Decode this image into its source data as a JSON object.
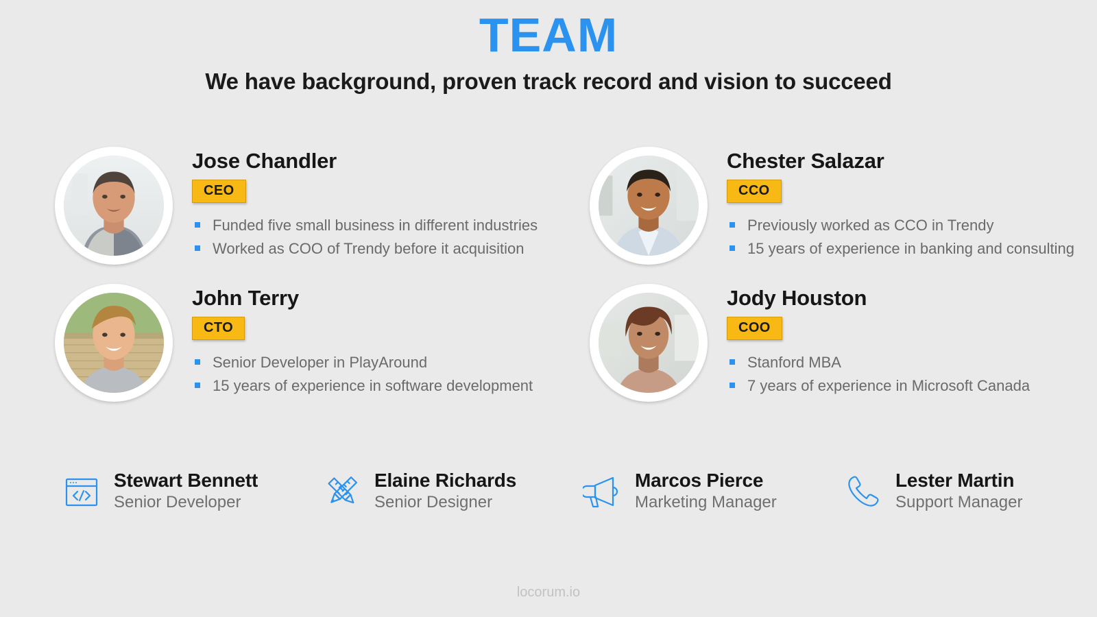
{
  "header": {
    "title": "TEAM",
    "subtitle": "We have background, proven track record and vision to succeed"
  },
  "colors": {
    "background": "#eaeaea",
    "accent_blue": "#2b93ef",
    "badge_amber": "#f9b915",
    "heading_dark": "#161616",
    "body_gray": "#6a6a6a",
    "footer_gray": "#c2c2c2"
  },
  "leaders": [
    {
      "name": "Jose Chandler",
      "badge": "CEO",
      "avatar": "photo-jose-chandler",
      "bullets": [
        "Funded five small business in different industries",
        "Worked as COO of Trendy before it acquisition"
      ]
    },
    {
      "name": "Chester Salazar",
      "badge": "CCO",
      "avatar": "photo-chester-salazar",
      "bullets": [
        "Previously worked as CCO in Trendy",
        "15 years of experience in banking and consulting"
      ]
    },
    {
      "name": "John Terry",
      "badge": "CTO",
      "avatar": "photo-john-terry",
      "bullets": [
        "Senior Developer in PlayAround",
        "15 years of experience in software development"
      ]
    },
    {
      "name": "Jody Houston",
      "badge": "COO",
      "avatar": "photo-jody-houston",
      "bullets": [
        "Stanford MBA",
        "7 years of experience in Microsoft Canada"
      ]
    }
  ],
  "staff": [
    {
      "name": "Stewart Bennett",
      "role": "Senior Developer",
      "icon": "code-window-icon"
    },
    {
      "name": "Elaine Richards",
      "role": "Senior Designer",
      "icon": "pencil-ruler-icon"
    },
    {
      "name": "Marcos Pierce",
      "role": "Marketing Manager",
      "icon": "megaphone-icon"
    },
    {
      "name": "Lester Martin",
      "role": "Support Manager",
      "icon": "phone-icon"
    }
  ],
  "footer": {
    "watermark": "locorum.io"
  }
}
